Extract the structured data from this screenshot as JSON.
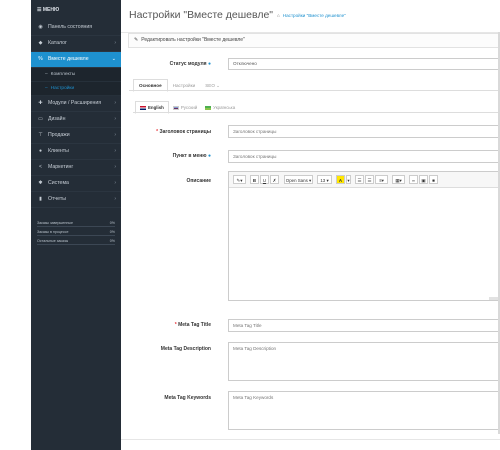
{
  "sidebar": {
    "brand": "☰ МЕНЮ",
    "items": [
      {
        "icon": "dashboard-icon",
        "glyph": "◉",
        "label": "Панель состояния",
        "chevron": ""
      },
      {
        "icon": "tag-icon",
        "glyph": "◆",
        "label": "Каталог",
        "chevron": "›"
      },
      {
        "icon": "percent-icon",
        "glyph": "%",
        "label": "Вместе дешевле",
        "chevron": "⌄",
        "active": true
      },
      {
        "icon": "puzzle-icon",
        "glyph": "✚",
        "label": "Модули / Расширения",
        "chevron": "›"
      },
      {
        "icon": "desktop-icon",
        "glyph": "▭",
        "label": "Дизайн",
        "chevron": "›"
      },
      {
        "icon": "cart-icon",
        "glyph": "⊤",
        "label": "Продажи",
        "chevron": "›"
      },
      {
        "icon": "user-icon",
        "glyph": "●",
        "label": "Клиенты",
        "chevron": "›"
      },
      {
        "icon": "share-icon",
        "glyph": "<",
        "label": "Маркетинг",
        "chevron": "›"
      },
      {
        "icon": "cog-icon",
        "glyph": "✱",
        "label": "Система",
        "chevron": "›"
      },
      {
        "icon": "bar-chart-icon",
        "glyph": "▮",
        "label": "Отчеты",
        "chevron": "›"
      }
    ],
    "subitems": [
      {
        "label": "Комплекты"
      },
      {
        "label": "Настройки"
      }
    ],
    "stats": [
      {
        "label": "Заказы завершенные",
        "pct": "0%",
        "fill": 0
      },
      {
        "label": "Заказы в процессе",
        "pct": "0%",
        "fill": 0
      },
      {
        "label": "Остальные заказы",
        "pct": "0%",
        "fill": 0
      }
    ]
  },
  "header": {
    "title": "Настройки \"Вместе дешевле\"",
    "breadcrumb": "Настройки \"Вместе дешевле\""
  },
  "panel": {
    "heading": "Редактировать настройки \"Вместе дешевле\"",
    "status_label": "Статус модуля",
    "status_value": "Отключено"
  },
  "tabs": [
    "Основное",
    "Настройки",
    "SEO"
  ],
  "languages": [
    {
      "label": "English",
      "active": true
    },
    {
      "label": "Русский",
      "active": false
    },
    {
      "label": "Українська",
      "active": false
    }
  ],
  "fields": {
    "page_title": {
      "label": "Заголовок страницы",
      "placeholder": "Заголовок страницы"
    },
    "menu_item": {
      "label": "Пункт в меню",
      "placeholder": "Заголовок страницы"
    },
    "description": {
      "label": "Описание"
    },
    "meta_title": {
      "label": "Meta Tag Title",
      "placeholder": "Meta Tag Title"
    },
    "meta_description": {
      "label": "Meta Tag Description",
      "placeholder": "Meta Tag Description"
    },
    "meta_keywords": {
      "label": "Meta Tag Keywords",
      "placeholder": "Meta Tag Keywords"
    }
  },
  "editor": {
    "font": "Open Sans ▾",
    "size": "13 ▾",
    "bold": "B",
    "underline": "U",
    "clear": "✗",
    "color": "A"
  },
  "colors": {
    "accent": "#1e91cf",
    "sidebar": "#242d37",
    "required": "#e8363b"
  }
}
